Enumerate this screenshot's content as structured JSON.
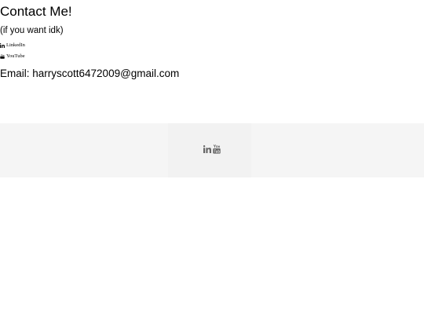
{
  "header": {
    "title": "Contact Me!",
    "subtitle": "(if you want idk)"
  },
  "social_links": [
    {
      "label": "LinkedIn",
      "icon": "linkedin-icon"
    },
    {
      "label": "YouTube",
      "icon": "youtube-icon"
    }
  ],
  "contact": {
    "email_text": "Email: harryscott6472009@gmail.com"
  },
  "footer": {
    "icons": [
      "linkedin-icon",
      "youtube-icon"
    ],
    "icon_color": "#666666",
    "background": "#f5f5f5"
  }
}
